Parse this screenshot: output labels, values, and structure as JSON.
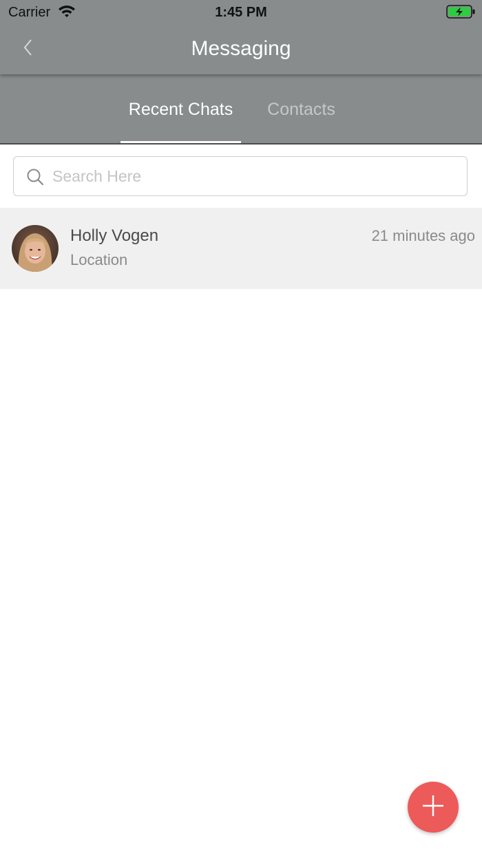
{
  "status_bar": {
    "carrier": "Carrier",
    "time": "1:45 PM",
    "battery_color": "#2ecc40"
  },
  "nav": {
    "title": "Messaging",
    "back_icon": "chevron-left-icon"
  },
  "tabs": [
    {
      "label": "Recent Chats",
      "active": true
    },
    {
      "label": "Contacts",
      "active": false
    }
  ],
  "search": {
    "placeholder": "Search Here",
    "value": "",
    "icon": "search-icon"
  },
  "chats": [
    {
      "name": "Holly Vogen",
      "preview": "Location",
      "time": "21 minutes ago"
    }
  ],
  "fab": {
    "icon": "plus-icon",
    "color": "#ec5a5a"
  },
  "colors": {
    "header": "#888c8c",
    "tab_active": "#ffffff",
    "tab_inactive": "#c6c8c8",
    "chat_row_bg": "#f0f0f0"
  }
}
